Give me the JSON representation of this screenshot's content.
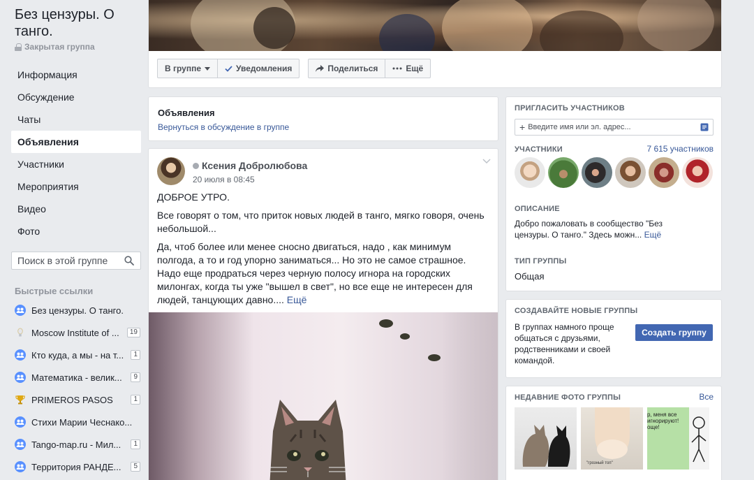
{
  "group": {
    "title": "Без цензуры. О танго.",
    "privacy": "Закрытая группа"
  },
  "nav": {
    "items": [
      {
        "label": "Информация"
      },
      {
        "label": "Обсуждение"
      },
      {
        "label": "Чаты"
      },
      {
        "label": "Объявления",
        "active": true
      },
      {
        "label": "Участники"
      },
      {
        "label": "Мероприятия"
      },
      {
        "label": "Видео"
      },
      {
        "label": "Фото"
      }
    ]
  },
  "search": {
    "placeholder": "Поиск в этой группе"
  },
  "quick_links": {
    "title": "Быстрые ссылки",
    "items": [
      {
        "label": "Без цензуры. О танго.",
        "badge": "",
        "icon": "group-icon"
      },
      {
        "label": "Moscow Institute of ...",
        "badge": "19",
        "icon": "bulb-icon"
      },
      {
        "label": "Кто куда, а мы - на т...",
        "badge": "1",
        "icon": "group-icon"
      },
      {
        "label": "Математика - велик...",
        "badge": "9",
        "icon": "group-icon"
      },
      {
        "label": "PRIMEROS PASOS",
        "badge": "1",
        "icon": "trophy-icon"
      },
      {
        "label": "Стихи Марии Чеснако...",
        "badge": "",
        "icon": "group-icon"
      },
      {
        "label": "Tango-map.ru - Мил...",
        "badge": "1",
        "icon": "group-icon"
      },
      {
        "label": "Территория РАНДЕ...",
        "badge": "5",
        "icon": "group-icon"
      }
    ]
  },
  "header_actions": {
    "in_group": "В группе",
    "notifications": "Уведомления",
    "share": "Поделиться",
    "more": "Ещё"
  },
  "announcements": {
    "title": "Объявления",
    "back_link": "Вернуться в обсуждение в группе"
  },
  "post": {
    "author": "Ксения Добролюбова",
    "time": "20 июля в 08:45",
    "paragraphs": [
      "ДОБРОЕ УТРО.",
      "Все говорят о том, что приток новых людей в танго, мягко говоря, очень небольшой...",
      "Да, чтоб более или менее сносно двигаться, надо , как минимум полгода, а то и год упорно заниматься... Но это не самое страшное. Надо еще продраться через черную полосу игнора на городских милонгах, когда ты уже \"вышел в свет\", но все еще не интересен для людей, танцующих давно...."
    ],
    "more_link": "Ещё"
  },
  "invite": {
    "title": "Пригласить участников",
    "placeholder": "Введите имя или эл. адрес..."
  },
  "members": {
    "title": "Участники",
    "count": "7 615 участников"
  },
  "description": {
    "title": "Описание",
    "text": "Добро пожаловать в сообщество \"Без цензуры. О танго.\" Здесь можн...",
    "more": "Ещё"
  },
  "group_type": {
    "title": "Тип группы",
    "value": "Общая"
  },
  "create_groups": {
    "title": "Создавайте новые группы",
    "text": "В группах намного проще общаться с друзьями, родственниками и своей командой.",
    "button": "Создать группу"
  },
  "recent_photos": {
    "title": "Недавние фото группы",
    "all_link": "Все",
    "photo2_caption": "\"грозный топ\"",
    "photo3_text": "р, меня все игнорируют! още!"
  },
  "colors": {
    "background": "#e9ebee",
    "link": "#385898",
    "button_primary": "#4267b2",
    "muted_text": "#90949c"
  }
}
